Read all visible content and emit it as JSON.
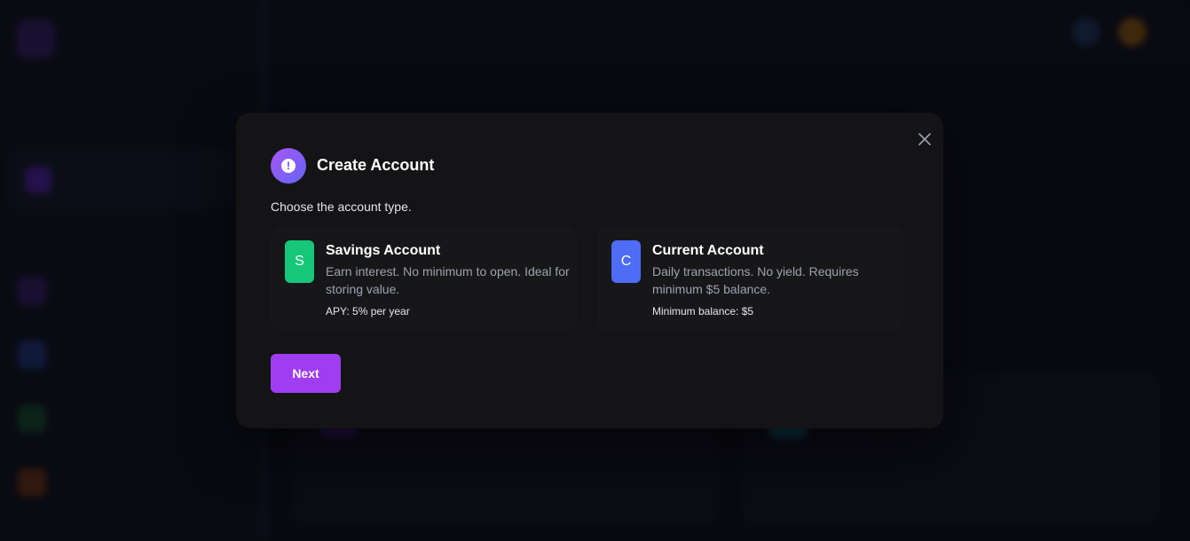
{
  "modal": {
    "title": "Create Account",
    "subtitle": "Choose the account type.",
    "next_label": "Next",
    "options": [
      {
        "badge": "S",
        "name": "Savings Account",
        "description": "Earn interest. No minimum to open. Ideal for storing value.",
        "extra": "APY: 5% per year",
        "color": "#16c77a"
      },
      {
        "badge": "C",
        "name": "Current Account",
        "description": "Daily transactions. No yield. Requires minimum $5 balance.",
        "extra": "Minimum balance: $5",
        "color": "#4f6cf7"
      }
    ]
  },
  "colors": {
    "accent": "#a03df0",
    "modal_bg": "#141416",
    "page_bg": "#0b0d14"
  }
}
